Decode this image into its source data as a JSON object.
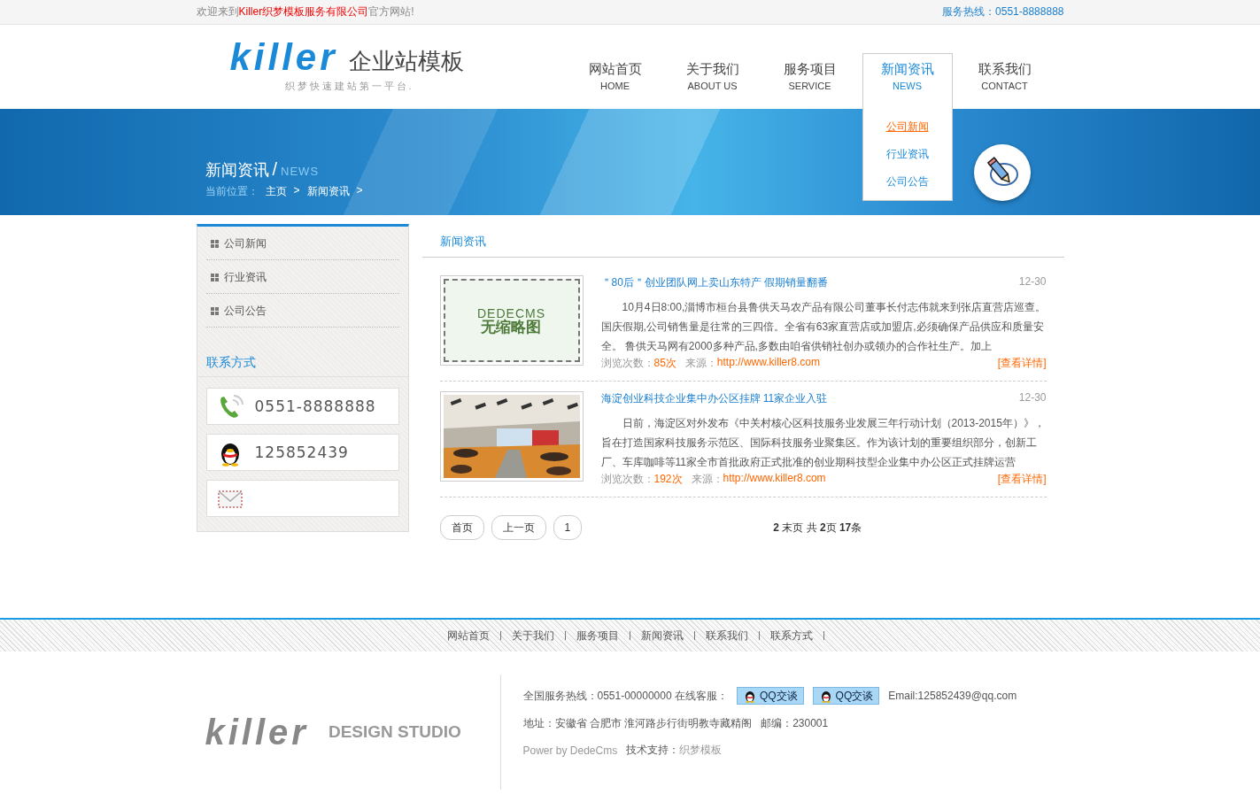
{
  "top_bar": {
    "welcome": {
      "before": "欢迎来到",
      "company": "Killer织梦模板服务有限公司",
      "after": "官方网站!"
    },
    "hotline": "服务热线：0551-8888888"
  },
  "header": {
    "logo": {
      "word": "killer",
      "title": "企业站模板",
      "slogan": "织梦快速建站第一平台."
    },
    "nav": [
      {
        "label": "网站首页",
        "sub": "HOME",
        "selected": false
      },
      {
        "label": "关于我们",
        "sub": "ABOUT US",
        "selected": false
      },
      {
        "label": "服务项目",
        "sub": "SERVICE",
        "selected": false
      },
      {
        "label": "新闻资讯",
        "sub": "NEWS",
        "selected": true,
        "dropdown": [
          {
            "label": "公司新闻",
            "selected": true
          },
          {
            "label": "行业资讯",
            "selected": false
          },
          {
            "label": "公司公告",
            "selected": false
          }
        ]
      },
      {
        "label": "联系我们",
        "sub": "CONTACT",
        "selected": false
      }
    ]
  },
  "banner": {
    "title": "新闻资讯",
    "separator": "/",
    "sub": "NEWS",
    "breadcrumb": {
      "label": "当前位置：",
      "items": [
        "主页",
        "新闻资讯"
      ],
      "separator": ">"
    }
  },
  "sidebar": {
    "categories": [
      "公司新闻",
      "行业资讯",
      "公司公告"
    ],
    "contact_heading": "联系方式",
    "contacts": [
      {
        "kind": "phone",
        "value": "0551-8888888"
      },
      {
        "kind": "qq",
        "value": "125852439"
      },
      {
        "kind": "mail"
      }
    ]
  },
  "main": {
    "heading": "新闻资讯",
    "articles": [
      {
        "thumbnail": {
          "kind": "placeholder",
          "lines": [
            "DEDECMS",
            "无缩略图"
          ]
        },
        "title": "＂80后＂创业团队网上卖山东特产 假期销量翻番",
        "date": "12-30",
        "summary": "10月4日8:00,淄博市桓台县鲁供天马农产品有限公司董事长付志伟就来到张店直营店巡查。国庆假期,公司销售量是往常的三四倍。全省有63家直营店或加盟店,必须确保产品供应和质量安全。 鲁供天马网有2000多种产品,多数由咱省供销社创办或领办的合作社生产。加上",
        "views_label": "浏览次数：",
        "views": "85次",
        "source_label": "来源：",
        "source": "http://www.killer8.com",
        "more": "[查看详情]"
      },
      {
        "title": "海淀创业科技企业集中办公区挂牌 11家企业入驻",
        "date": "12-30",
        "summary": "日前，海淀区对外发布《中关村核心区科技服务业发展三年行动计划（2013-2015年）》，旨在打造国家科技服务示范区、国际科技服务业聚集区。作为该计划的重要组织部分，创新工厂、车库咖啡等11家全市首批政府正式批准的创业期科技型企业集中办公区正式挂牌运营",
        "views_label": "浏览次数：",
        "views": "192次",
        "source_label": "来源：",
        "source": "http://www.killer8.com",
        "more": "[查看详情]"
      }
    ],
    "pagination": {
      "buttons": [
        "首页",
        "上一页",
        "1"
      ],
      "info": "**2** 末页 共 **2**页 **17**条"
    }
  },
  "footer": {
    "links": [
      "网站首页",
      "关于我们",
      "服务项目",
      "新闻资讯",
      "联系我们",
      "联系方式"
    ],
    "logo": {
      "word": "killer",
      "tagline": "DESIGN STUDIO"
    },
    "hotline": "全国服务热线：0551-00000000 在线客服：",
    "qq_buttons": [
      "QQ交谈",
      "QQ交谈"
    ],
    "email": "Email:125852439@qq.com",
    "address": "地址：安徽省 合肥市 淮河路步行街明教寺藏精阁",
    "postcode": "邮编：230001",
    "power": "Power by DedeCms",
    "support_label": "技术支持：",
    "support": "织梦模板"
  }
}
